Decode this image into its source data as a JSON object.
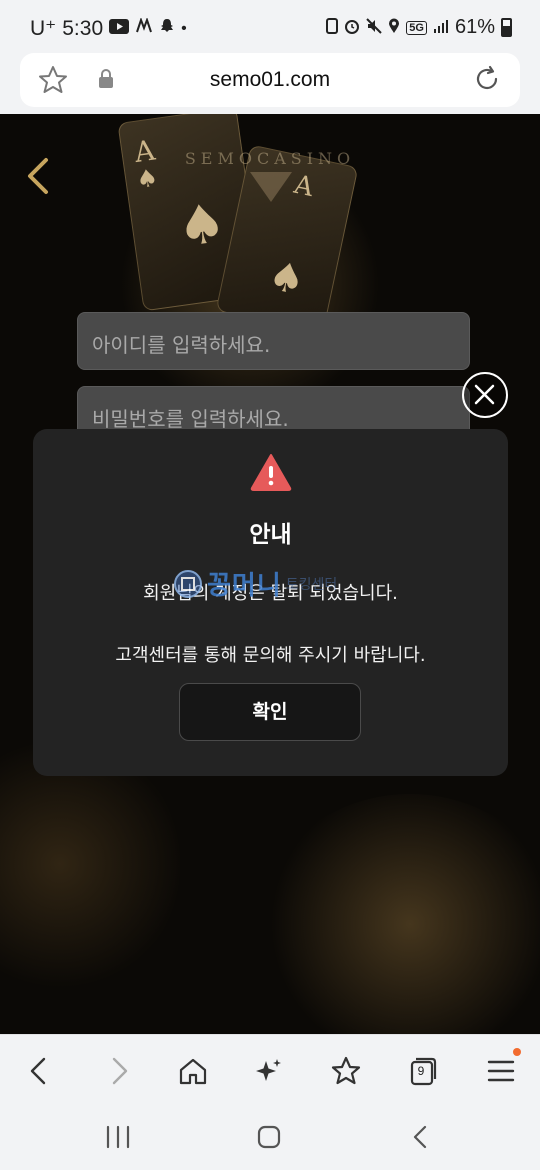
{
  "status_bar": {
    "carrier": "U⁺",
    "time": "5:30",
    "network": "5G",
    "battery": "61%"
  },
  "browser": {
    "url": "semo01.com",
    "tab_count": "9"
  },
  "page": {
    "brand": "SEMOCASINO",
    "id_placeholder": "아이디를 입력하세요.",
    "pw_placeholder": "비밀번호를 입력하세요."
  },
  "dialog": {
    "title": "안내",
    "message_line1": "회원님의 계정은 탈퇴 되었습니다.",
    "message_line2": "고객센터를 통해 문의해 주시기 바랍니다.",
    "confirm_label": "확인"
  },
  "watermark": {
    "text": "꽁머니",
    "subtext": "토킹센터"
  },
  "colors": {
    "warning": "#e65a5a",
    "dialog_bg": "#232323",
    "notification_dot": "#f26b2f"
  },
  "icons": {
    "status": [
      "youtube-icon",
      "notification-icon",
      "snapchat-icon",
      "alarm-icon",
      "mute-icon",
      "location-icon",
      "signal-icon",
      "battery-icon"
    ],
    "toolbar": [
      "back-icon",
      "forward-icon",
      "home-icon",
      "sparkle-icon",
      "bookmark-star-icon",
      "tabs-icon",
      "menu-icon"
    ]
  }
}
